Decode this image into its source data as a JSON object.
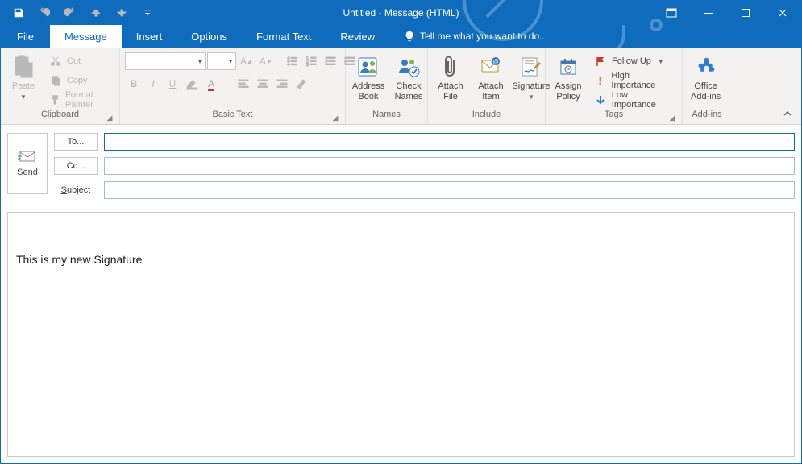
{
  "window": {
    "title": "Untitled - Message (HTML)"
  },
  "tabs": {
    "file": "File",
    "items": [
      "Message",
      "Insert",
      "Options",
      "Format Text",
      "Review"
    ],
    "active_index": 0,
    "tellme": "Tell me what you want to do..."
  },
  "ribbon": {
    "clipboard": {
      "label": "Clipboard",
      "paste": "Paste",
      "cut": "Cut",
      "copy": "Copy",
      "format_painter": "Format Painter"
    },
    "basictext": {
      "label": "Basic Text"
    },
    "names": {
      "label": "Names",
      "address_book": "Address\nBook",
      "check_names": "Check\nNames"
    },
    "include": {
      "label": "Include",
      "attach_file": "Attach\nFile",
      "attach_item": "Attach\nItem",
      "signature": "Signature"
    },
    "tags": {
      "label": "Tags",
      "assign_policy": "Assign\nPolicy",
      "follow_up": "Follow Up",
      "high": "High Importance",
      "low": "Low Importance"
    },
    "addins": {
      "label": "Add-ins",
      "office": "Office\nAdd-ins"
    }
  },
  "compose": {
    "send": "Send",
    "to": "To...",
    "cc": "Cc...",
    "subject": "Subject",
    "to_value": "",
    "cc_value": "",
    "subject_value": ""
  },
  "body": {
    "text": "This is my new Signature"
  }
}
